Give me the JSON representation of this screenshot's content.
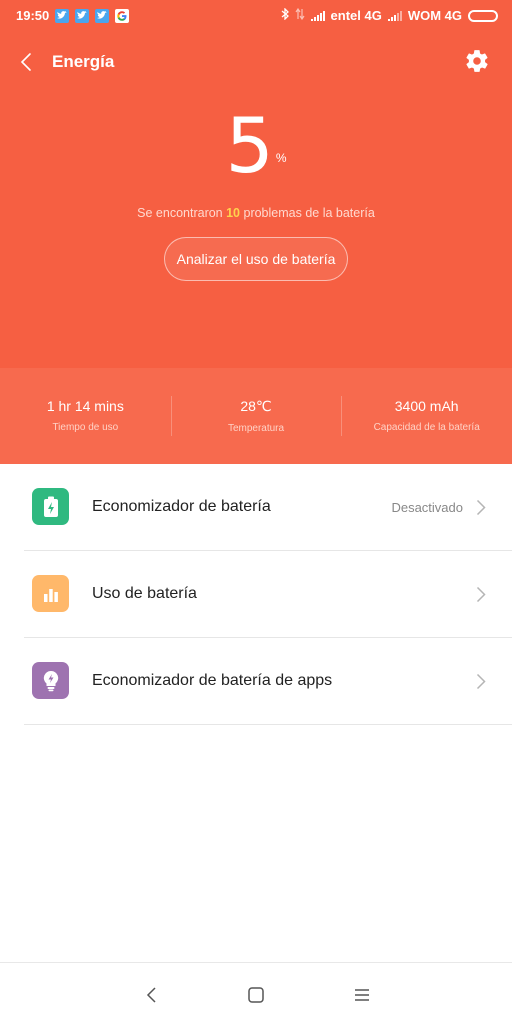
{
  "status_bar": {
    "time": "19:50",
    "notifications": [
      "twitter-icon",
      "twitter-icon",
      "twitter-icon",
      "google-icon"
    ],
    "carrier1": "entel 4G",
    "carrier2": "WOM 4G"
  },
  "header": {
    "title": "Energía"
  },
  "battery": {
    "percent": "5",
    "percent_sign": "%",
    "problems_prefix": "Se encontraron ",
    "problems_count": "10",
    "problems_suffix": " problemas de la batería",
    "analyze_label": "Analizar el uso de batería"
  },
  "stats": [
    {
      "value": "1 hr 14 mins",
      "label": "Tiempo de uso"
    },
    {
      "value": "28℃",
      "label": "Temperatura"
    },
    {
      "value": "3400 mAh",
      "label": "Capacidad de la batería"
    }
  ],
  "list": [
    {
      "label": "Economizador de batería",
      "value": "Desactivado",
      "icon": "battery-saver-icon",
      "color": "#2fb980"
    },
    {
      "label": "Uso de batería",
      "value": "",
      "icon": "bar-chart-icon",
      "color": "#ffb86a"
    },
    {
      "label": "Economizador de batería de apps",
      "value": "",
      "icon": "lightbulb-icon",
      "color": "#9e73b0"
    }
  ],
  "colors": {
    "accent": "#f65f42",
    "stats_bg": "#f76a4e",
    "highlight": "#ffd34d"
  }
}
